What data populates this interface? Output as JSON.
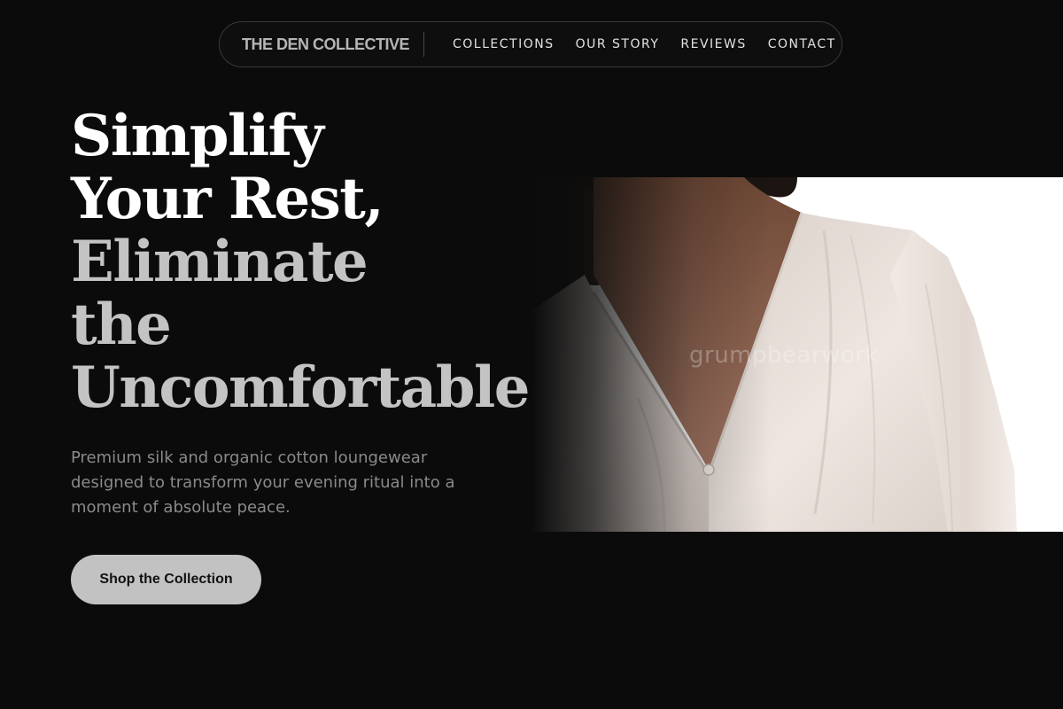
{
  "nav": {
    "brand": "THE DEN COLLECTIVE",
    "links": [
      "COLLECTIONS",
      "OUR STORY",
      "REVIEWS",
      "CONTACT"
    ]
  },
  "hero": {
    "title_lines": [
      "Simplify",
      "Your Rest,",
      "Eliminate",
      "the",
      "Uncomfortable."
    ],
    "description": "Premium silk and organic cotton loungewear designed to transform your evening ritual into a moment of absolute peace.",
    "cta_label": "Shop the Collection",
    "image_watermark": "grumpbearwork"
  },
  "colors": {
    "background": "#0b0b0b",
    "title_primary": "#ffffff",
    "title_secondary": "#c3c3c3",
    "body_text": "#8a8a8a",
    "cta_background": "#c2c2c2",
    "cta_text": "#111111"
  }
}
